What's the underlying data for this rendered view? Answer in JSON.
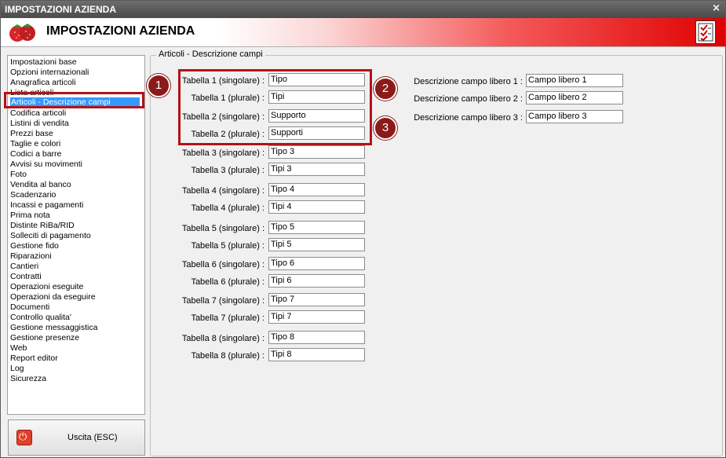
{
  "window": {
    "title": "IMPOSTAZIONI AZIENDA",
    "close_glyph": "×"
  },
  "header": {
    "title": "IMPOSTAZIONI AZIENDA",
    "logo_icon": "strawberry-logo",
    "checklist_icon": "checklist-icon"
  },
  "sidebar": {
    "items": [
      {
        "label": "Impostazioni base"
      },
      {
        "label": "Opzioni internazionali"
      },
      {
        "label": "Anagrafica articoli"
      },
      {
        "label": "Lista articoli"
      },
      {
        "label": "Articoli - Descrizione campi",
        "selected": true
      },
      {
        "label": "Codifica articoli"
      },
      {
        "label": "Listini di vendita"
      },
      {
        "label": "Prezzi base"
      },
      {
        "label": "Taglie e colori"
      },
      {
        "label": "Codici a barre"
      },
      {
        "label": "Avvisi su movimenti"
      },
      {
        "label": "Foto"
      },
      {
        "label": "Vendita al banco"
      },
      {
        "label": "Scadenzario"
      },
      {
        "label": "Incassi e pagamenti"
      },
      {
        "label": "Prima nota"
      },
      {
        "label": "Distinte RiBa/RID"
      },
      {
        "label": "Solleciti di pagamento"
      },
      {
        "label": "Gestione fido"
      },
      {
        "label": "Riparazioni"
      },
      {
        "label": "Cantieri"
      },
      {
        "label": "Contratti"
      },
      {
        "label": "Operazioni eseguite"
      },
      {
        "label": "Operazioni da eseguire"
      },
      {
        "label": "Documenti"
      },
      {
        "label": "Controllo qualita'"
      },
      {
        "label": "Gestione messaggistica"
      },
      {
        "label": "Gestione presenze"
      },
      {
        "label": "Web"
      },
      {
        "label": "Report editor"
      },
      {
        "label": "Log"
      },
      {
        "label": "Sicurezza"
      }
    ]
  },
  "exit_button": {
    "label": "Uscita (ESC)",
    "icon": "power-icon"
  },
  "main": {
    "group_title": "Articoli - Descrizione campi",
    "tables": [
      {
        "label": "Tabella 1 (singolare) :",
        "value": "Tipo"
      },
      {
        "label": "Tabella 1 (plurale) :",
        "value": "Tipi"
      },
      {
        "label": "Tabella 2 (singolare) :",
        "value": "Supporto"
      },
      {
        "label": "Tabella 2 (plurale) :",
        "value": "Supporti"
      },
      {
        "label": "Tabella 3 (singolare) :",
        "value": "Tipo 3"
      },
      {
        "label": "Tabella 3 (plurale) :",
        "value": "Tipi 3"
      },
      {
        "label": "Tabella 4 (singolare) :",
        "value": "Tipo 4"
      },
      {
        "label": "Tabella 4 (plurale) :",
        "value": "Tipi 4"
      },
      {
        "label": "Tabella 5 (singolare) :",
        "value": "Tipo 5"
      },
      {
        "label": "Tabella 5 (plurale) :",
        "value": "Tipi 5"
      },
      {
        "label": "Tabella 6 (singolare) :",
        "value": "Tipo 6"
      },
      {
        "label": "Tabella 6 (plurale) :",
        "value": "Tipi 6"
      },
      {
        "label": "Tabella 7 (singolare) :",
        "value": "Tipo 7"
      },
      {
        "label": "Tabella 7 (plurale) :",
        "value": "Tipi 7"
      },
      {
        "label": "Tabella 8 (singolare) :",
        "value": "Tipo 8"
      },
      {
        "label": "Tabella 8 (plurale) :",
        "value": "Tipi 8"
      }
    ],
    "free_fields": [
      {
        "label": "Descrizione campo libero 1 :",
        "value": "Campo libero 1"
      },
      {
        "label": "Descrizione campo libero 2 :",
        "value": "Campo libero 2"
      },
      {
        "label": "Descrizione campo libero 3 :",
        "value": "Campo libero 3"
      }
    ]
  },
  "annotations": {
    "badges": [
      "1",
      "2",
      "3"
    ],
    "highlight_color": "#b31217"
  }
}
